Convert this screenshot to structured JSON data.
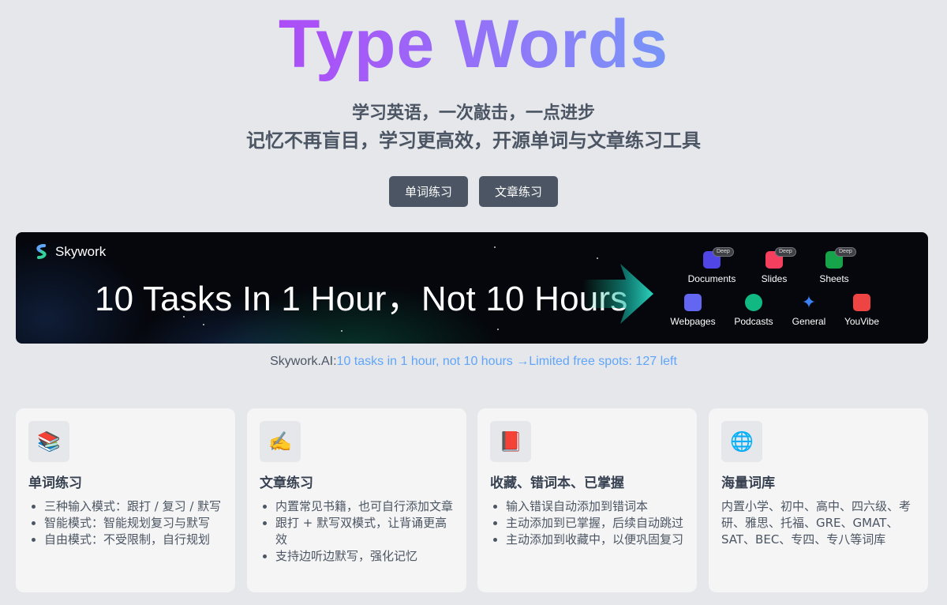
{
  "hero": {
    "title": "Type Words",
    "subtitle1": "学习英语，一次敲击，一点进步",
    "subtitle2": "记忆不再盲目，学习更高效，开源单词与文章练习工具"
  },
  "buttons": {
    "word_practice": "单词练习",
    "article_practice": "文章练习"
  },
  "banner": {
    "brand": "Skywork",
    "headline": "10 Tasks In 1 Hour，Not 10 Hours",
    "deep_label": "Deep",
    "tools": [
      {
        "label": "Documents",
        "icon": "documents-icon",
        "color": "#4f46e5"
      },
      {
        "label": "Slides",
        "icon": "slides-icon",
        "color": "#f43f5e"
      },
      {
        "label": "Sheets",
        "icon": "sheets-icon",
        "color": "#16a34a"
      },
      {
        "label": "Webpages",
        "icon": "webpages-icon",
        "color": "#6366f1"
      },
      {
        "label": "Podcasts",
        "icon": "podcasts-icon",
        "color": "#10b981"
      },
      {
        "label": "General",
        "icon": "sparkle-icon",
        "color": "#3b82f6"
      },
      {
        "label": "YouVibe",
        "icon": "youvibe-icon",
        "color": "#ef4444"
      }
    ]
  },
  "promo": {
    "label": "Skywork.AI:",
    "link": "10 tasks in 1 hour, not 10 hours →Limited free spots: 127 left"
  },
  "features": [
    {
      "icon": "books-icon",
      "title": "单词练习",
      "items": [
        "三种输入模式：跟打 / 复习 / 默写",
        "智能模式：智能规划复习与默写",
        "自由模式：不受限制，自行规划"
      ]
    },
    {
      "icon": "writing-hand-icon",
      "title": "文章练习",
      "items": [
        "内置常见书籍，也可自行添加文章",
        "跟打 + 默写双模式，让背诵更高效",
        "支持边听边默写，强化记忆"
      ]
    },
    {
      "icon": "red-book-icon",
      "title": "收藏、错词本、已掌握",
      "items": [
        "输入错误自动添加到错词本",
        "主动添加到已掌握，后续自动跳过",
        "主动添加到收藏中，以便巩固复习"
      ]
    },
    {
      "icon": "globe-icon",
      "title": "海量词库",
      "text": "内置小学、初中、高中、四六级、考研、雅思、托福、GRE、GMAT、SAT、BEC、专四、专八等词库"
    }
  ]
}
